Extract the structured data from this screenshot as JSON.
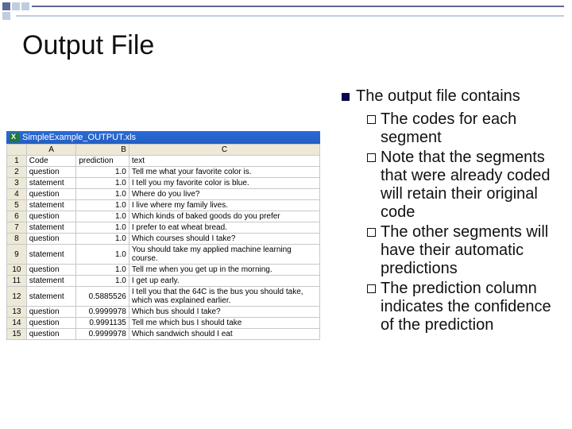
{
  "title": "Output File",
  "spreadsheet": {
    "titlebar": "SimpleExample_OUTPUT.xls",
    "columns": [
      "A",
      "B",
      "C"
    ],
    "header": {
      "a": "Code",
      "b": "prediction",
      "c": "text"
    },
    "rows": [
      {
        "a": "question",
        "b": "1.0",
        "c": "Tell me what your favorite color is."
      },
      {
        "a": "statement",
        "b": "1.0",
        "c": "I tell you my favorite color is blue."
      },
      {
        "a": "question",
        "b": "1.0",
        "c": "Where do you live?"
      },
      {
        "a": "statement",
        "b": "1.0",
        "c": "I live where my family lives."
      },
      {
        "a": "question",
        "b": "1.0",
        "c": "Which kinds of baked goods do you prefer"
      },
      {
        "a": "statement",
        "b": "1.0",
        "c": "I prefer to eat wheat bread."
      },
      {
        "a": "question",
        "b": "1.0",
        "c": "Which courses should I take?"
      },
      {
        "a": "statement",
        "b": "1.0",
        "c": "You should take my applied machine learning course."
      },
      {
        "a": "question",
        "b": "1.0",
        "c": "Tell me when you get up in the morning."
      },
      {
        "a": "statement",
        "b": "1.0",
        "c": "I get up early."
      },
      {
        "a": "statement",
        "b": "0.5885526",
        "c": "I tell you that the 64C is the bus you should take, which was explained earlier."
      },
      {
        "a": "question",
        "b": "0.9999978",
        "c": "Which bus should I take?"
      },
      {
        "a": "question",
        "b": "0.9991135",
        "c": "Tell me which bus I should take"
      },
      {
        "a": "question",
        "b": "0.9999978",
        "c": "Which sandwich should I eat"
      }
    ]
  },
  "bullets": {
    "lead": "The output file contains",
    "sub": [
      "The codes for each segment",
      "Note that the segments that were already coded will retain their original code",
      "The other segments will have their automatic predictions",
      "The prediction column indicates the confidence of the prediction"
    ]
  },
  "chart_data": {
    "type": "table",
    "title": "SimpleExample_OUTPUT.xls",
    "columns": [
      "Code",
      "prediction",
      "text"
    ],
    "rows": [
      [
        "question",
        1.0,
        "Tell me what your favorite color is."
      ],
      [
        "statement",
        1.0,
        "I tell you my favorite color is blue."
      ],
      [
        "question",
        1.0,
        "Where do you live?"
      ],
      [
        "statement",
        1.0,
        "I live where my family lives."
      ],
      [
        "question",
        1.0,
        "Which kinds of baked goods do you prefer"
      ],
      [
        "statement",
        1.0,
        "I prefer to eat wheat bread."
      ],
      [
        "question",
        1.0,
        "Which courses should I take?"
      ],
      [
        "statement",
        1.0,
        "You should take my applied machine learning course."
      ],
      [
        "question",
        1.0,
        "Tell me when you get up in the morning."
      ],
      [
        "statement",
        1.0,
        "I get up early."
      ],
      [
        "statement",
        0.5885526,
        "I tell you that the 64C is the bus you should take, which was explained earlier."
      ],
      [
        "question",
        0.9999978,
        "Which bus should I take?"
      ],
      [
        "question",
        0.9991135,
        "Tell me which bus I should take"
      ],
      [
        "question",
        0.9999978,
        "Which sandwich should I eat"
      ]
    ]
  }
}
